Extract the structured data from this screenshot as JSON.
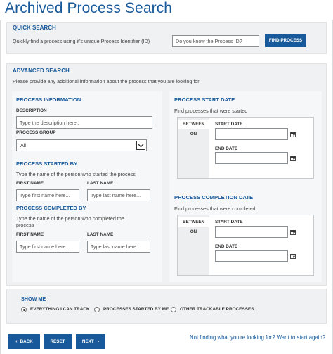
{
  "page": {
    "title": "Archived Process Search"
  },
  "quick_search": {
    "heading": "QUICK SEARCH",
    "description": "Quickly find a process using it's unique Process Identifier (ID)",
    "id_placeholder": "Do you know the Process ID?",
    "find_button": "FIND PROCESS"
  },
  "advanced_search": {
    "heading": "ADVANCED SEARCH",
    "description": "Please provide any additional information about the process that you are looking for",
    "process_information": {
      "heading": "PROCESS INFORMATION",
      "description_label": "DESCRIPTION",
      "description_placeholder": "Type the description here..",
      "group_label": "PROCESS GROUP",
      "group_selected": "All"
    },
    "started_by": {
      "heading": "PROCESS STARTED BY",
      "description": "Type the name of the person who started the process",
      "first_name_label": "FIRST NAME",
      "first_name_placeholder": "Type first name here...",
      "last_name_label": "LAST NAME",
      "last_name_placeholder": "Type last name here..."
    },
    "completed_by": {
      "heading": "PROCESS COMPLETED BY",
      "description_line1": "Type the name of the person who completed the",
      "description_line2": "process",
      "first_name_label": "FIRST NAME",
      "first_name_placeholder": "Type first name here...",
      "last_name_label": "LAST NAME",
      "last_name_placeholder": "Type last name here..."
    },
    "start_date": {
      "heading": "PROCESS START DATE",
      "description": "Find processes that were started",
      "tab_between": "BETWEEN",
      "tab_on": "ON",
      "start_label": "START DATE",
      "end_label": "END DATE"
    },
    "completion_date": {
      "heading": "PROCESS COMPLETION DATE",
      "description": "Find processes that were completed",
      "tab_between": "BETWEEN",
      "tab_on": "ON",
      "start_label": "START DATE",
      "end_label": "END DATE"
    }
  },
  "show_me": {
    "heading": "SHOW ME",
    "options": [
      "EVERYTHING I CAN TRACK",
      "PROCESSES STARTED BY ME",
      "OTHER TRACKABLE PROCESSES"
    ],
    "selected": "EVERYTHING I CAN TRACK"
  },
  "footer": {
    "back_label": "BACK",
    "reset_label": "RESET",
    "next_label": "NEXT",
    "help_link": "Not finding what you're looking for? Want to start again?"
  },
  "icons": {
    "back": "chevron-left-icon",
    "next": "chevron-right-icon",
    "calendar": "calendar-icon",
    "dropdown": "chevron-down-icon"
  },
  "colors": {
    "brand": "#17599a",
    "panel": "#f0f1f2"
  }
}
